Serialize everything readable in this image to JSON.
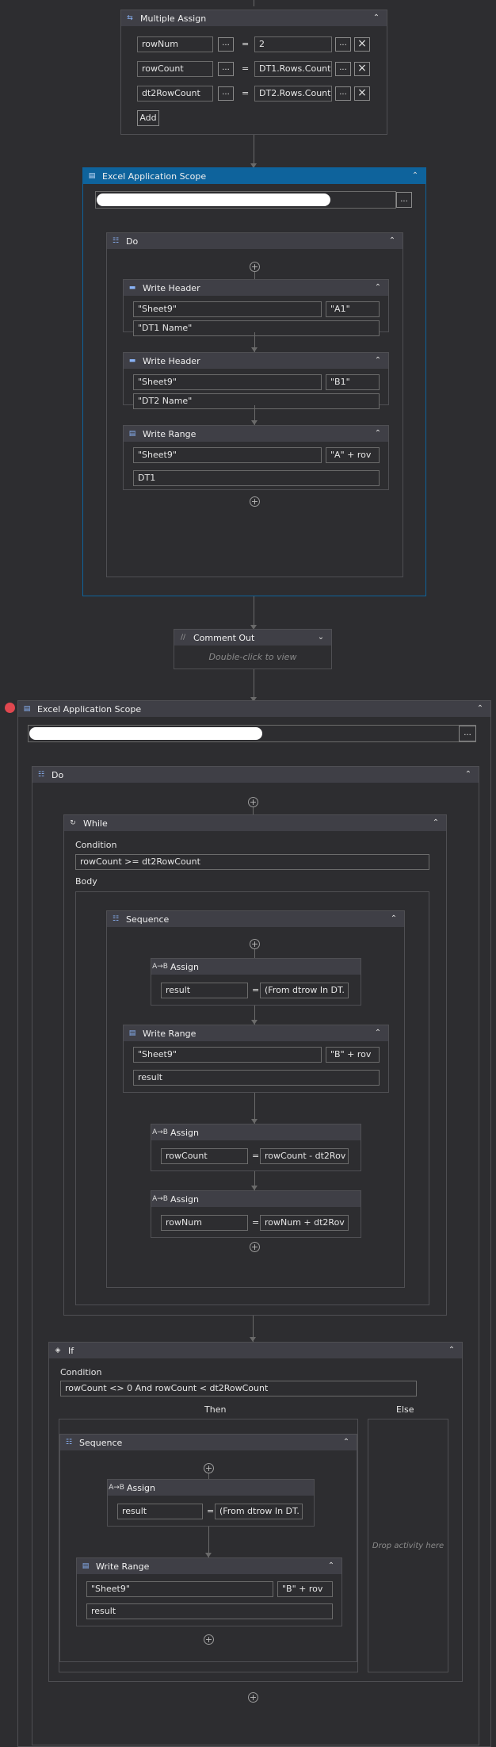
{
  "multiple_assign": {
    "title": "Multiple Assign",
    "rows": [
      {
        "variable": "rowNum",
        "value": "2"
      },
      {
        "variable": "rowCount",
        "value": "DT1.Rows.Count"
      },
      {
        "variable": "dt2RowCount",
        "value": "DT2.Rows.Count"
      }
    ],
    "equals": "=",
    "dots": "...",
    "add_label": "Add"
  },
  "scope1": {
    "title": "Excel Application Scope",
    "dots": "...",
    "do_title": "Do",
    "write_header_1": {
      "title": "Write Header",
      "sheet": "\"Sheet9\"",
      "cell": "\"A1\"",
      "value": "\"DT1 Name\""
    },
    "write_header_2": {
      "title": "Write Header",
      "sheet": "\"Sheet9\"",
      "cell": "\"B1\"",
      "value": "\"DT2 Name\""
    },
    "write_range": {
      "title": "Write Range",
      "sheet": "\"Sheet9\"",
      "cell": "\"A\" + rov",
      "value": "DT1"
    }
  },
  "comment_out": {
    "title": "Comment Out",
    "hint": "Double-click to view"
  },
  "scope2": {
    "title": "Excel Application Scope",
    "dots": "...",
    "do_title": "Do",
    "while": {
      "title": "While",
      "condition_label": "Condition",
      "condition": "rowCount >= dt2RowCount",
      "body_label": "Body",
      "sequence_title": "Sequence",
      "assign1": {
        "title": "Assign",
        "to": "result",
        "value": "(From dtrow In DT."
      },
      "write_range": {
        "title": "Write Range",
        "sheet": "\"Sheet9\"",
        "cell": "\"B\" + rov",
        "value": "result"
      },
      "assign2": {
        "title": "Assign",
        "to": "rowCount",
        "value": "rowCount - dt2Rov"
      },
      "assign3": {
        "title": "Assign",
        "to": "rowNum",
        "value": "rowNum + dt2Rov"
      }
    },
    "if": {
      "title": "If",
      "condition_label": "Condition",
      "condition": "rowCount <> 0 And rowCount < dt2RowCount",
      "then_label": "Then",
      "else_label": "Else",
      "else_hint": "Drop activity here",
      "sequence_title": "Sequence",
      "assign": {
        "title": "Assign",
        "to": "result",
        "value": "(From dtrow In DT."
      },
      "write_range": {
        "title": "Write Range",
        "sheet": "\"Sheet9\"",
        "cell": "\"B\" + rov",
        "value": "result"
      }
    }
  },
  "eq": "=",
  "icons": {
    "collapse": "double-chevron-up-icon",
    "expand": "double-chevron-down-icon",
    "add": "plus-circle-icon",
    "breakpoint": "breakpoint-icon"
  },
  "colors": {
    "background": "#2d2d30",
    "header": "#3f3f46",
    "selected_header": "#0e639c",
    "breakpoint": "#e0474f"
  }
}
